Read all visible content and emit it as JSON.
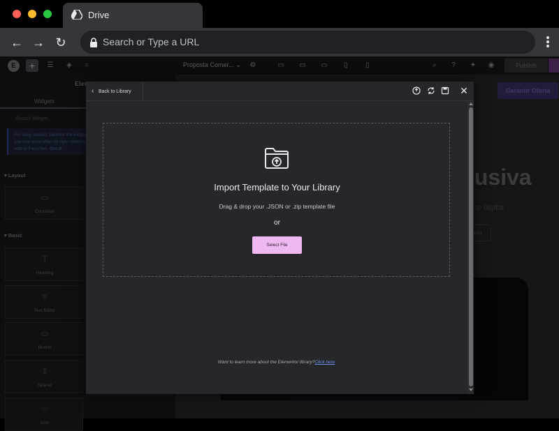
{
  "browser": {
    "tab_title": "Drive",
    "address_placeholder": "Search or Type a URL"
  },
  "editor": {
    "page_name": "Proposta Comer...",
    "publish_label": "Publish",
    "sidebar": {
      "title": "Elemen",
      "tab": "Widgets",
      "search_placeholder": "Search Widget...",
      "note": "For easy access, favorite the widgets you use most often by right clicking > Add to Favorites.",
      "note_link": "Got It",
      "sections": [
        {
          "label": "Layout",
          "widgets": [
            {
              "label": "Container",
              "icon": "container-icon"
            }
          ]
        },
        {
          "label": "Basic",
          "widgets": [
            {
              "label": "Heading",
              "icon": "heading-icon"
            },
            {
              "label": "Text Editor",
              "icon": "text-editor-icon"
            },
            {
              "label": "Button",
              "icon": "button-icon"
            },
            {
              "label": "Spacer",
              "icon": "spacer-icon"
            },
            {
              "label": "Icon",
              "icon": "star-icon"
            }
          ]
        }
      ]
    },
    "canvas": {
      "cta_label": "Garantir Oferta",
      "hero_title": "lusiva",
      "hero_sub": "no digital",
      "hero_button": "ada"
    }
  },
  "modal": {
    "back_label": "Back to Library",
    "header_icons": [
      "info-icon",
      "sync-icon",
      "save-icon",
      "close-icon"
    ],
    "import_title": "Import Template to Your Library",
    "import_sub": "Drag & drop your .JSON or .zip template file",
    "or_label": "or",
    "select_file_label": "Select File",
    "footer_text": "Want to learn more about the Elementor library?",
    "footer_link": "Click here"
  },
  "colors": {
    "select_button": "#f0b8f0",
    "link": "#6d8fe8",
    "modal_bg": "#26272b"
  }
}
